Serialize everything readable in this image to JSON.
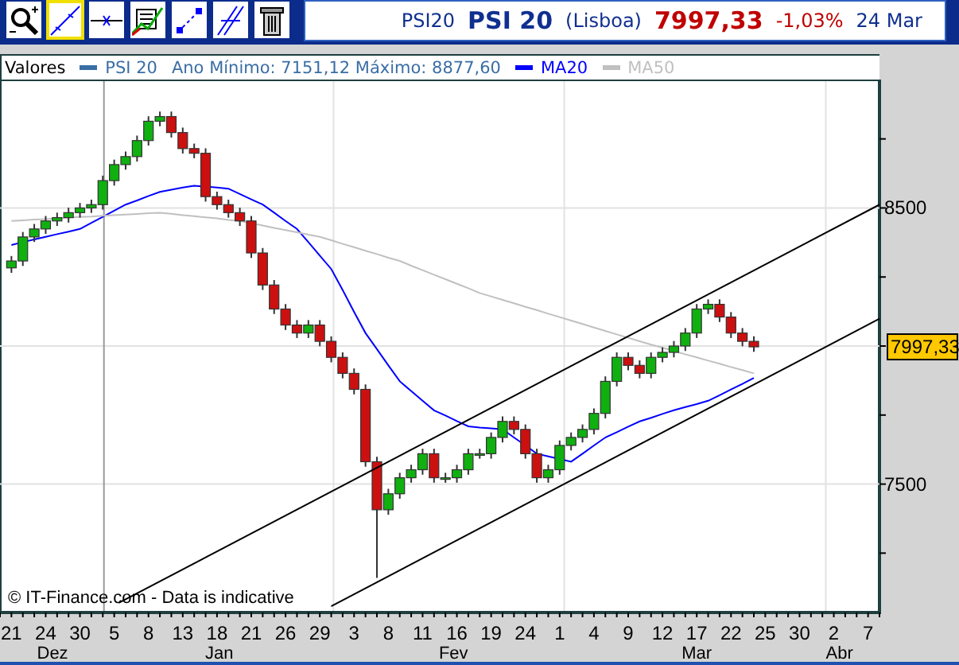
{
  "toolbar": {
    "tools": [
      {
        "selected": false
      },
      {
        "selected": true
      },
      {
        "selected": false
      },
      {
        "selected": false
      },
      {
        "selected": false
      },
      {
        "selected": false
      },
      {
        "selected": false
      }
    ]
  },
  "header": {
    "symbol": "PSI20",
    "name": "PSI 20",
    "exchange": "(Lisboa)",
    "price": "7997,33",
    "change": "-1,03%",
    "date": "24 Mar"
  },
  "legend": {
    "title": "Valores",
    "series_label": "PSI 20",
    "color": "#3a6ea5",
    "range": "Ano Mínimo: 7151,12 Máximo: 8877,60"
  },
  "chart": {
    "chart_data": {
      "type": "candlestick",
      "grid": true,
      "ylim": [
        7035,
        8965
      ],
      "yticks": [
        7500,
        8500
      ],
      "categories": [
        "21",
        null,
        null,
        "24",
        null,
        null,
        "30",
        null,
        null,
        "5",
        null,
        null,
        "8",
        null,
        null,
        "13",
        null,
        null,
        "18",
        null,
        null,
        "21",
        null,
        null,
        "26",
        null,
        null,
        "29",
        null,
        null,
        "3",
        null,
        null,
        "8",
        null,
        null,
        "11",
        null,
        null,
        "16",
        null,
        null,
        "19",
        null,
        null,
        "24",
        null,
        null,
        "1",
        null,
        null,
        "4",
        null,
        null,
        "9",
        null,
        null,
        "12",
        null,
        null,
        "17",
        null,
        null,
        "22",
        null,
        null,
        "25",
        null,
        null,
        "30",
        null,
        null,
        "2",
        null,
        null,
        "7"
      ],
      "ohlc": [
        [
          8283,
          8326,
          8265,
          8308
        ],
        [
          8308,
          8413,
          8290,
          8395
        ],
        [
          8395,
          8442,
          8377,
          8424
        ],
        [
          8424,
          8471,
          8406,
          8453
        ],
        [
          8453,
          8483,
          8435,
          8465
        ],
        [
          8465,
          8501,
          8447,
          8483
        ],
        [
          8483,
          8518,
          8465,
          8500
        ],
        [
          8500,
          8530,
          8482,
          8512
        ],
        [
          8512,
          8617,
          8494,
          8599
        ],
        [
          8599,
          8675,
          8581,
          8657
        ],
        [
          8657,
          8704,
          8639,
          8686
        ],
        [
          8686,
          8762,
          8668,
          8744
        ],
        [
          8744,
          8832,
          8726,
          8814
        ],
        [
          8814,
          8849,
          8796,
          8831
        ],
        [
          8831,
          8849,
          8755,
          8773
        ],
        [
          8773,
          8791,
          8697,
          8715
        ],
        [
          8715,
          8733,
          8680,
          8698
        ],
        [
          8698,
          8716,
          8523,
          8541
        ],
        [
          8541,
          8559,
          8494,
          8512
        ],
        [
          8512,
          8530,
          8465,
          8483
        ],
        [
          8483,
          8501,
          8435,
          8453
        ],
        [
          8453,
          8471,
          8319,
          8337
        ],
        [
          8337,
          8355,
          8203,
          8221
        ],
        [
          8221,
          8239,
          8116,
          8134
        ],
        [
          8134,
          8152,
          8058,
          8076
        ],
        [
          8076,
          8094,
          8029,
          8047
        ],
        [
          8047,
          8094,
          8029,
          8076
        ],
        [
          8076,
          8094,
          7999,
          8017
        ],
        [
          8017,
          8035,
          7941,
          7959
        ],
        [
          7959,
          7977,
          7883,
          7901
        ],
        [
          7901,
          7919,
          7825,
          7843
        ],
        [
          7843,
          7861,
          7563,
          7581
        ],
        [
          7581,
          7599,
          7160,
          7407
        ],
        [
          7407,
          7483,
          7389,
          7465
        ],
        [
          7465,
          7541,
          7447,
          7523
        ],
        [
          7523,
          7570,
          7505,
          7552
        ],
        [
          7552,
          7628,
          7534,
          7610
        ],
        [
          7610,
          7628,
          7505,
          7523
        ],
        [
          7523,
          7541,
          7505,
          7523
        ],
        [
          7523,
          7570,
          7505,
          7552
        ],
        [
          7552,
          7628,
          7534,
          7610
        ],
        [
          7610,
          7628,
          7592,
          7610
        ],
        [
          7610,
          7687,
          7592,
          7669
        ],
        [
          7669,
          7745,
          7651,
          7727
        ],
        [
          7727,
          7745,
          7680,
          7698
        ],
        [
          7698,
          7716,
          7592,
          7610
        ],
        [
          7610,
          7628,
          7505,
          7523
        ],
        [
          7523,
          7570,
          7505,
          7552
        ],
        [
          7552,
          7658,
          7534,
          7640
        ],
        [
          7640,
          7687,
          7622,
          7669
        ],
        [
          7669,
          7716,
          7651,
          7698
        ],
        [
          7698,
          7774,
          7680,
          7756
        ],
        [
          7756,
          7890,
          7738,
          7872
        ],
        [
          7872,
          7977,
          7854,
          7959
        ],
        [
          7959,
          7977,
          7912,
          7930
        ],
        [
          7930,
          7948,
          7883,
          7901
        ],
        [
          7901,
          7977,
          7883,
          7959
        ],
        [
          7959,
          7995,
          7941,
          7977
        ],
        [
          7977,
          8018,
          7959,
          8000
        ],
        [
          8000,
          8065,
          7982,
          8047
        ],
        [
          8047,
          8152,
          8029,
          8134
        ],
        [
          8134,
          8169,
          8116,
          8151
        ],
        [
          8151,
          8169,
          8087,
          8105
        ],
        [
          8105,
          8123,
          8029,
          8047
        ],
        [
          8047,
          8065,
          7999,
          8017
        ],
        [
          8017,
          8035,
          7979,
          7997
        ],
        null,
        null,
        null,
        null,
        null,
        null,
        null,
        null,
        null,
        null
      ],
      "series": [
        {
          "name": "MA20",
          "type": "line",
          "color": "#0000ff",
          "values": [
            8366,
            8376,
            8386,
            8395,
            8405,
            8414,
            8424,
            8446,
            8468,
            8490,
            8512,
            8527,
            8543,
            8558,
            8566,
            8574,
            8581,
            8577,
            8574,
            8570,
            8551,
            8531,
            8512,
            8483,
            8453,
            8424,
            8376,
            8327,
            8279,
            8202,
            8124,
            8047,
            7989,
            7930,
            7872,
            7837,
            7802,
            7767,
            7748,
            7728,
            7709,
            7705,
            7702,
            7698,
            7669,
            7640,
            7610,
            7600,
            7591,
            7581,
            7610,
            7640,
            7669,
            7688,
            7708,
            7727,
            7740,
            7754,
            7767,
            7779,
            7790,
            7802,
            7822,
            7843,
            7863,
            7884,
            null,
            null,
            null,
            null,
            null,
            null,
            null,
            null,
            null,
            null
          ]
        },
        {
          "name": "MA50",
          "type": "line",
          "color": "#c0c0c0",
          "values": [
            8453,
            8455,
            8458,
            8460,
            8462,
            8465,
            8467,
            8469,
            8472,
            8474,
            8476,
            8478,
            8481,
            8483,
            8479,
            8474,
            8470,
            8466,
            8462,
            8457,
            8453,
            8445,
            8436,
            8428,
            8420,
            8412,
            8403,
            8395,
            8383,
            8370,
            8358,
            8345,
            8333,
            8320,
            8308,
            8291,
            8275,
            8258,
            8242,
            8225,
            8209,
            8192,
            8180,
            8167,
            8155,
            8142,
            8130,
            8117,
            8105,
            8092,
            8080,
            8067,
            8055,
            8042,
            8030,
            8017,
            8005,
            7994,
            7982,
            7970,
            7959,
            7947,
            7936,
            7924,
            7913,
            7901,
            null,
            null,
            null,
            null,
            null,
            null,
            null,
            null,
            null,
            null
          ]
        }
      ]
    },
    "months": [
      "Dez",
      "Jan",
      "Fev",
      "Mar",
      "Abr"
    ],
    "price_flag": "7997,33",
    "credit": "© IT-Finance.com - Data is indicative"
  }
}
